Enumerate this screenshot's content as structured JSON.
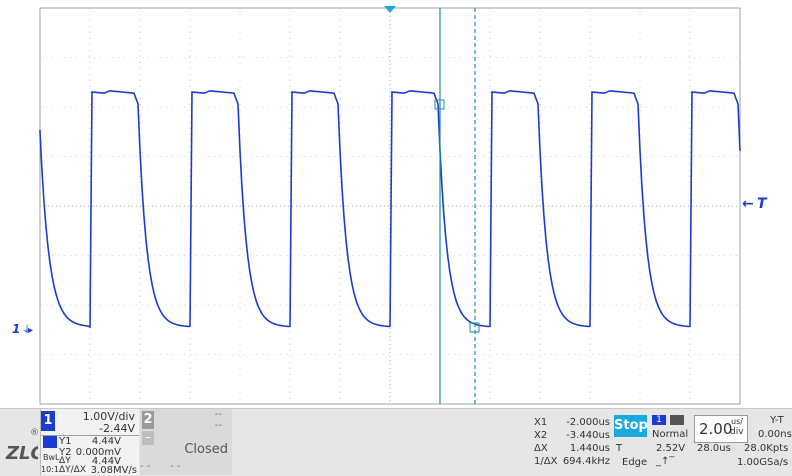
{
  "markers": {
    "trigger_level": "T",
    "channel1_ground": "1"
  },
  "channel1": {
    "number": "1",
    "scale": "1.00V/div",
    "offset": "-2.44V",
    "color": "#1a3dcf"
  },
  "cursors_y": {
    "y1_label": "Y1",
    "y1_value": "4.44V",
    "y2_label": "Y2",
    "y2_value": "0.000mV",
    "dy_label": "ΔY",
    "dy_value": "4.44V",
    "rate_label": "ΔY/ΔX",
    "rate_value": "3.08MV/s",
    "bw_label": "BwL",
    "ratio_label": "10:1",
    "gnd_label": "⏚"
  },
  "channel2": {
    "number": "2",
    "minus": "–",
    "dash1": "--",
    "dash2": "--",
    "status": "Closed",
    "dots1": "- -",
    "dots2": "- -"
  },
  "cursors_x": {
    "x1_label": "X1",
    "x1_value": "-2.000us",
    "x2_label": "X2",
    "x2_value": "-3.440us",
    "dx_label": "ΔX",
    "dx_value": "1.440us",
    "inv_label": "1/ΔX",
    "inv_value": "694.4kHz"
  },
  "acquisition": {
    "stop_label": "Stop",
    "mode": "Normal",
    "trigger_source_badge": "1",
    "trigger_label": "T",
    "trigger_level": "2.52V",
    "trigger_type": "Edge"
  },
  "timebase": {
    "value": "2.00",
    "unit_top": "us/",
    "unit_bottom": "div",
    "mode": "Y-T",
    "delay": "0.00ns",
    "memory_time": "28.0us",
    "memory_points": "28.0Kpts",
    "sample_rate": "1.00GSa/s"
  },
  "colors": {
    "waveform": "#1a3dcf",
    "cursor": "#1a8fa6",
    "stop": "#19a9e1",
    "grid": "#b0b0b0"
  }
}
